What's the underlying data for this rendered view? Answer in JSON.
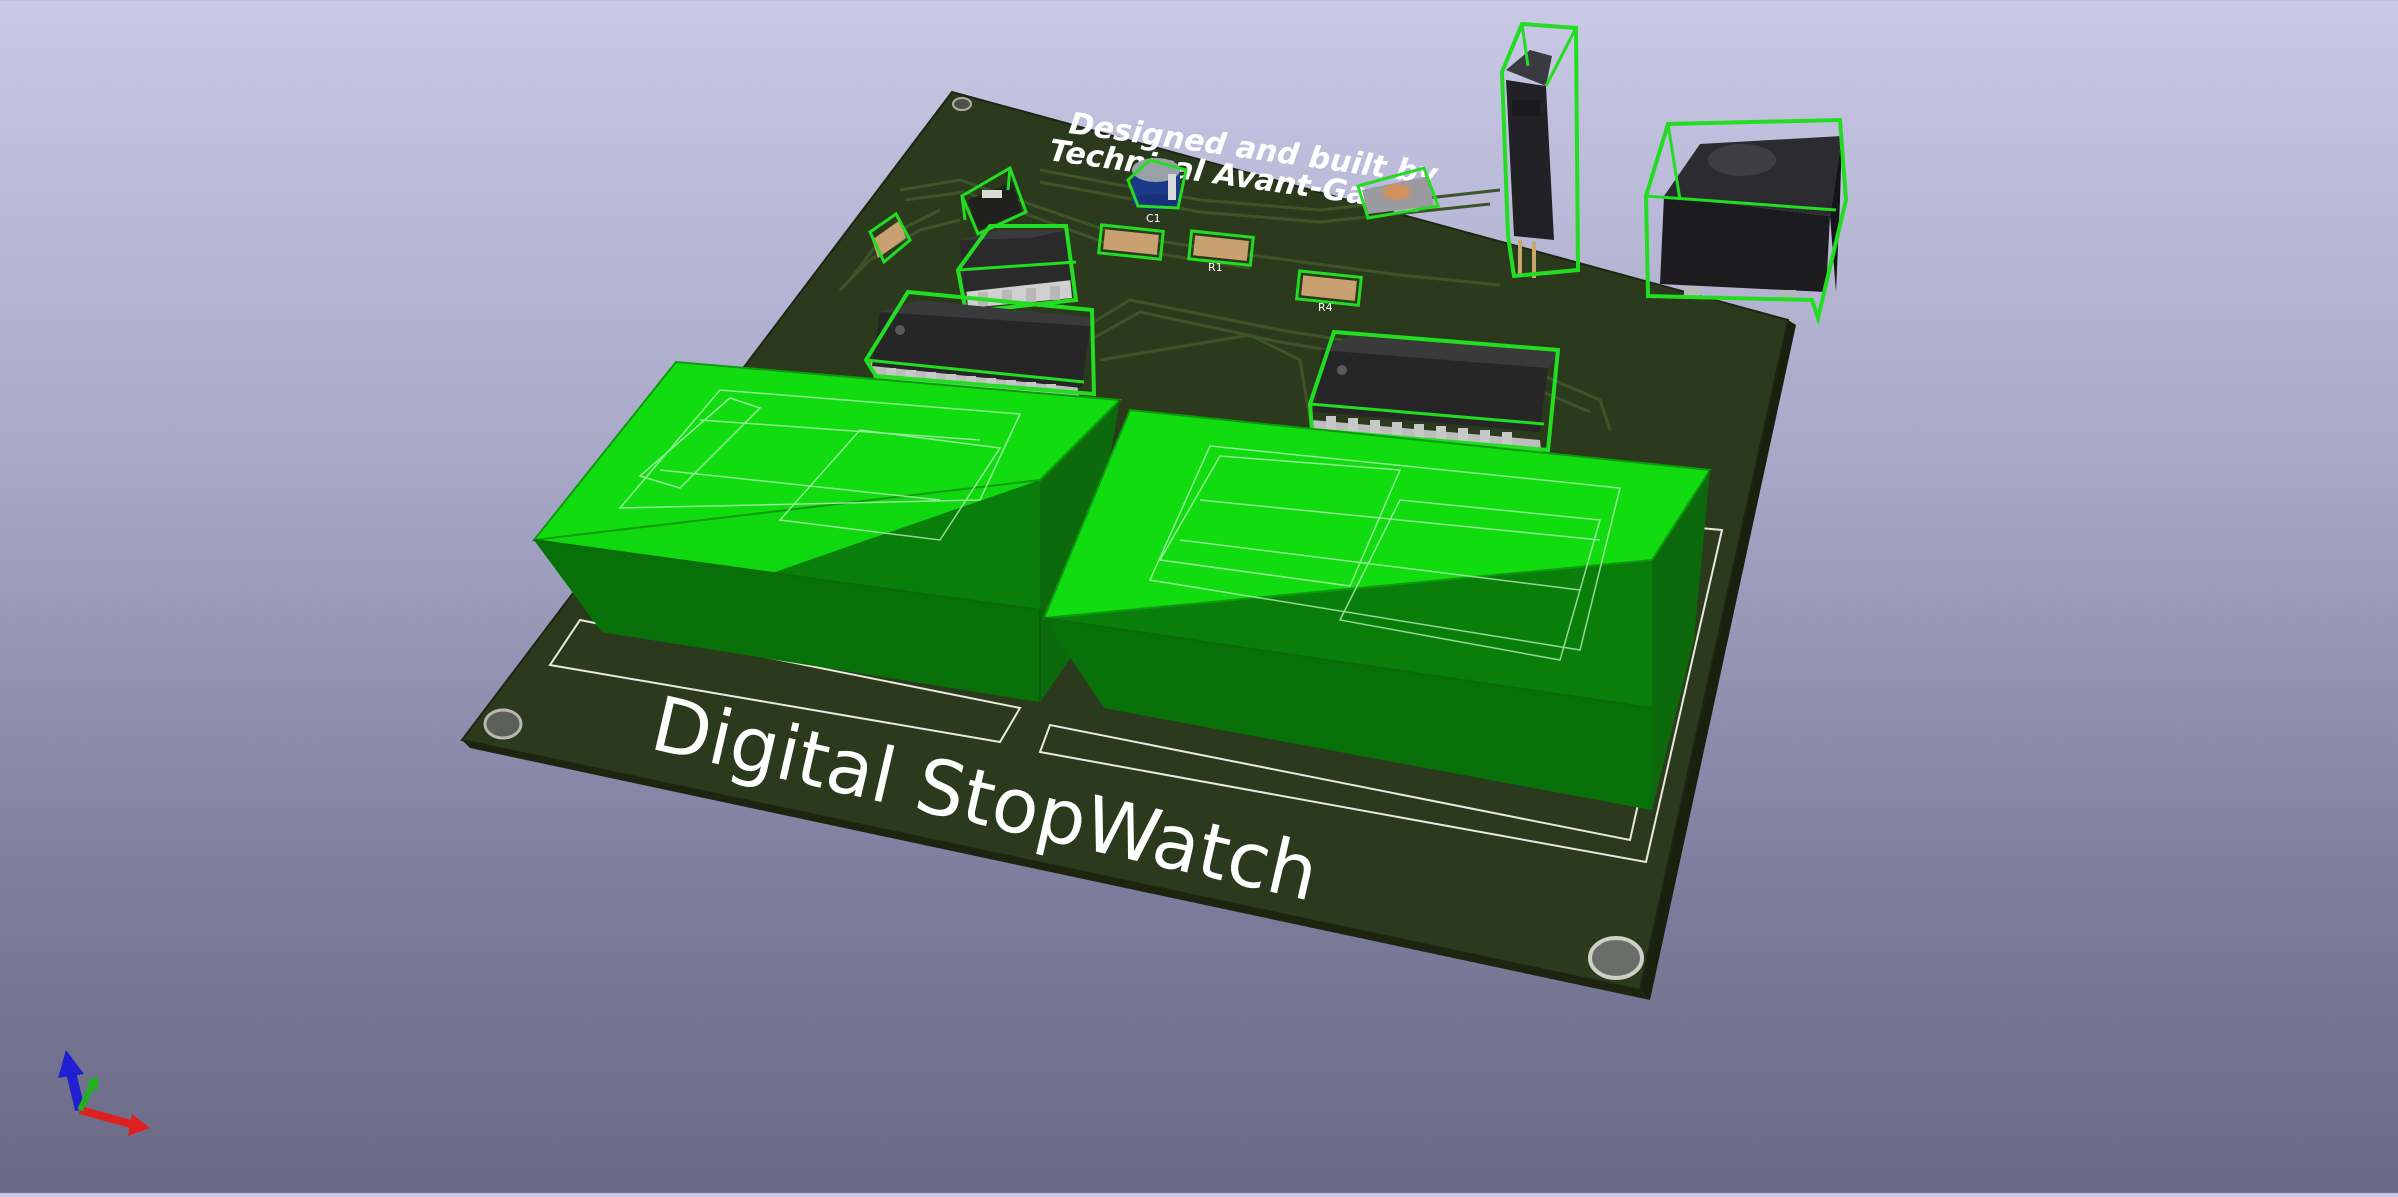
{
  "viewer": {
    "board_texts": {
      "credit_line1": "Designed and built by",
      "credit_line2": "Technical Avant-Garde",
      "title": "Digital StopWatch"
    },
    "refdes": {
      "c1": "C1",
      "r1": "R1",
      "r4": "R4"
    },
    "colors": {
      "background_top": "#c9c9e6",
      "background_bottom": "#6a6a86",
      "board": "#2b3a1c",
      "silkscreen": "#ffffff",
      "selection_highlight": "#22dd22",
      "display_body": "#0fd80f"
    },
    "icons": {
      "axis": "xyz-axis-triad-icon"
    }
  }
}
